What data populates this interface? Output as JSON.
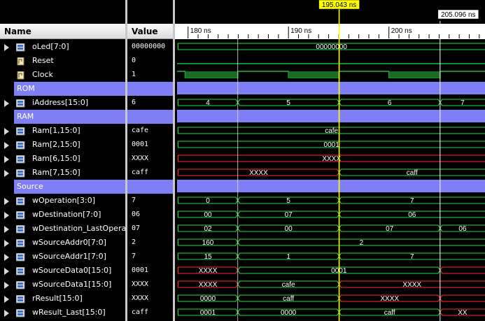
{
  "columns": {
    "name": "Name",
    "value": "Value"
  },
  "cursors": [
    {
      "label": "195.043 ns",
      "time": 195.043,
      "color": "#ffff00"
    },
    {
      "label": "205.096 ns",
      "time": 205.096,
      "color": "#ffffff"
    }
  ],
  "timeline": {
    "ticks": [
      "180 ns",
      "190 ns",
      "200 ns"
    ],
    "tick_times": [
      180,
      190,
      200
    ],
    "start": 179.0,
    "end": 209.5
  },
  "signals": [
    {
      "name": "oLed[7:0]",
      "value": "00000000",
      "kind": "bus",
      "icon": "bus-icon",
      "expandable": true,
      "segments": [
        {
          "from": 179,
          "to": 210,
          "label": "00000000",
          "color": "green"
        }
      ]
    },
    {
      "name": "Reset",
      "value": "0",
      "kind": "bit",
      "icon": "bit-icon",
      "expandable": false,
      "level": 0
    },
    {
      "name": "Clock",
      "value": "1",
      "kind": "clock",
      "icon": "bit-icon",
      "expandable": false
    },
    {
      "name": "ROM",
      "kind": "group"
    },
    {
      "name": "iAddress[15:0]",
      "value": "6",
      "kind": "bus",
      "icon": "bus-icon",
      "expandable": true,
      "segments": [
        {
          "from": 179,
          "to": 184.95,
          "label": "4",
          "color": "green"
        },
        {
          "from": 184.95,
          "to": 195.04,
          "label": "5",
          "color": "green"
        },
        {
          "from": 195.04,
          "to": 205.1,
          "label": "6",
          "color": "green"
        },
        {
          "from": 205.1,
          "to": 212,
          "label": "7",
          "color": "green"
        }
      ]
    },
    {
      "name": "RAM",
      "kind": "group"
    },
    {
      "name": "Ram[1,15:0]",
      "value": "cafe",
      "kind": "bus",
      "icon": "bus-icon",
      "expandable": true,
      "segments": [
        {
          "from": 179,
          "to": 210,
          "label": "cafe",
          "color": "green"
        }
      ]
    },
    {
      "name": "Ram[2,15:0]",
      "value": "0001",
      "kind": "bus",
      "icon": "bus-icon",
      "expandable": true,
      "segments": [
        {
          "from": 179,
          "to": 210,
          "label": "0001",
          "color": "green"
        }
      ]
    },
    {
      "name": "Ram[6,15:0]",
      "value": "XXXX",
      "kind": "bus",
      "icon": "bus-icon",
      "expandable": true,
      "segments": [
        {
          "from": 179,
          "to": 210,
          "label": "XXXX",
          "color": "red"
        }
      ]
    },
    {
      "name": "Ram[7,15:0]",
      "value": "caff",
      "kind": "bus",
      "icon": "bus-icon",
      "expandable": true,
      "segments": [
        {
          "from": 179,
          "to": 195.04,
          "label": "XXXX",
          "color": "red"
        },
        {
          "from": 195.04,
          "to": 210,
          "label": "caff",
          "color": "green"
        }
      ]
    },
    {
      "name": "Source",
      "kind": "group"
    },
    {
      "name": "wOperation[3:0]",
      "value": "7",
      "kind": "bus",
      "icon": "bus-icon",
      "expandable": true,
      "segments": [
        {
          "from": 179,
          "to": 184.95,
          "label": "0",
          "color": "green"
        },
        {
          "from": 184.95,
          "to": 195.04,
          "label": "5",
          "color": "green"
        },
        {
          "from": 195.04,
          "to": 210,
          "label": "7",
          "color": "green"
        }
      ]
    },
    {
      "name": "wDestination[7:0]",
      "value": "06",
      "kind": "bus",
      "icon": "bus-icon",
      "expandable": true,
      "segments": [
        {
          "from": 179,
          "to": 184.95,
          "label": "00",
          "color": "green"
        },
        {
          "from": 184.95,
          "to": 195.04,
          "label": "07",
          "color": "green"
        },
        {
          "from": 195.04,
          "to": 210,
          "label": "06",
          "color": "green"
        }
      ]
    },
    {
      "name": "wDestination_LastOperat",
      "value": "07",
      "kind": "bus",
      "icon": "bus-icon",
      "expandable": true,
      "segments": [
        {
          "from": 179,
          "to": 184.95,
          "label": "02",
          "color": "green"
        },
        {
          "from": 184.95,
          "to": 195.04,
          "label": "00",
          "color": "green"
        },
        {
          "from": 195.04,
          "to": 205.1,
          "label": "07",
          "color": "green"
        },
        {
          "from": 205.1,
          "to": 212,
          "label": "06",
          "color": "green"
        }
      ]
    },
    {
      "name": "wSourceAddr0[7:0]",
      "value": "2",
      "kind": "bus",
      "icon": "bus-icon",
      "expandable": true,
      "segments": [
        {
          "from": 179,
          "to": 184.95,
          "label": "160",
          "color": "green"
        },
        {
          "from": 184.95,
          "to": 210,
          "label": "2",
          "color": "green"
        }
      ]
    },
    {
      "name": "wSourceAddr1[7:0]",
      "value": "7",
      "kind": "bus",
      "icon": "bus-icon",
      "expandable": true,
      "segments": [
        {
          "from": 179,
          "to": 184.95,
          "label": "15",
          "color": "green"
        },
        {
          "from": 184.95,
          "to": 195.04,
          "label": "1",
          "color": "green"
        },
        {
          "from": 195.04,
          "to": 210,
          "label": "7",
          "color": "green"
        }
      ]
    },
    {
      "name": "wSourceData0[15:0]",
      "value": "0001",
      "kind": "bus",
      "icon": "bus-icon",
      "expandable": true,
      "segments": [
        {
          "from": 179,
          "to": 184.95,
          "label": "XXXX",
          "color": "red"
        },
        {
          "from": 184.95,
          "to": 205.1,
          "label": "0001",
          "color": "green"
        },
        {
          "from": 205.1,
          "to": 212,
          "label": "",
          "color": "red"
        }
      ]
    },
    {
      "name": "wSourceData1[15:0]",
      "value": "XXXX",
      "kind": "bus",
      "icon": "bus-icon",
      "expandable": true,
      "segments": [
        {
          "from": 179,
          "to": 184.95,
          "label": "XXXX",
          "color": "red"
        },
        {
          "from": 184.95,
          "to": 195.04,
          "label": "cafe",
          "color": "green"
        },
        {
          "from": 195.04,
          "to": 210,
          "label": "XXXX",
          "color": "red"
        }
      ]
    },
    {
      "name": "rResult[15:0]",
      "value": "XXXX",
      "kind": "bus",
      "icon": "bus-icon",
      "expandable": true,
      "segments": [
        {
          "from": 179,
          "to": 184.95,
          "label": "0000",
          "color": "green"
        },
        {
          "from": 184.95,
          "to": 195.04,
          "label": "caff",
          "color": "green"
        },
        {
          "from": 195.04,
          "to": 205.1,
          "label": "XXXX",
          "color": "red"
        },
        {
          "from": 205.1,
          "to": 212,
          "label": "",
          "color": "red"
        }
      ]
    },
    {
      "name": "wResult_Last[15:0]",
      "value": "caff",
      "kind": "bus",
      "icon": "bus-icon",
      "expandable": true,
      "segments": [
        {
          "from": 179,
          "to": 184.95,
          "label": "0001",
          "color": "green"
        },
        {
          "from": 184.95,
          "to": 195.04,
          "label": "0000",
          "color": "green"
        },
        {
          "from": 195.04,
          "to": 205.1,
          "label": "caff",
          "color": "green"
        },
        {
          "from": 205.1,
          "to": 212,
          "label": "XX",
          "color": "red"
        }
      ]
    }
  ],
  "colors": {
    "wave_green": "#22e03a",
    "wave_red": "#ff2a2a",
    "group": "#7f7ff5",
    "cursor_yellow": "#ffff00",
    "cursor_white": "#ffffff"
  }
}
